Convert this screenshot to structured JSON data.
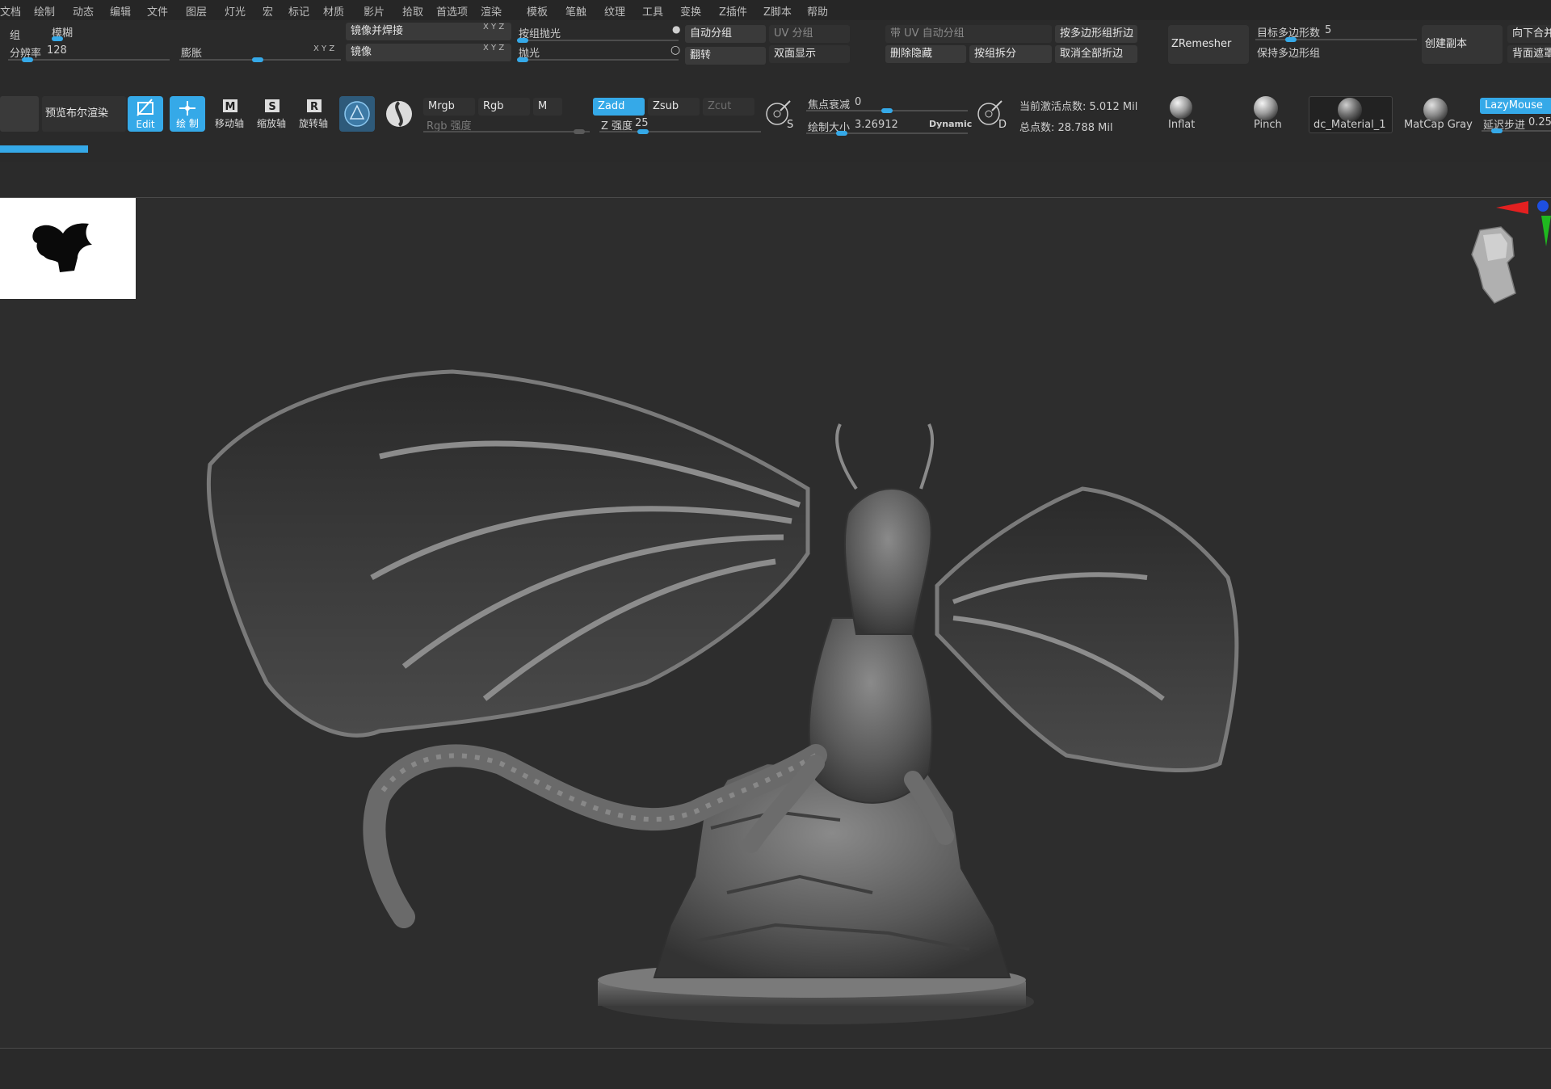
{
  "menu": [
    "文档",
    "绘制",
    "动态",
    "编辑",
    "文件",
    "图层",
    "灯光",
    "宏",
    "标记",
    "材质",
    "影片",
    "拾取",
    "首选项",
    "渲染",
    "模板",
    "笔触",
    "纹理",
    "工具",
    "变换",
    "Z插件",
    "Z脚本",
    "帮助"
  ],
  "row1": {
    "group": "组",
    "blur": "模糊",
    "resolution_label": "分辨率",
    "resolution_value": "128",
    "inflate": "膨胀",
    "xyz": "X Y Z",
    "mirror_weld": "镜像并焊接",
    "mirror": "镜像",
    "polish_by_groups": "按组抛光",
    "polish": "抛光",
    "auto_groups": "自动分组",
    "flip": "翻转",
    "uv_groups": "UV 分组",
    "double_sided": "双面显示",
    "with_uv_auto_groups": "带 UV 自动分组",
    "delete_hidden": "删除隐藏",
    "split_groups": "按组拆分",
    "crease_pg": "按多边形组折边",
    "uncrease_all": "取消全部折边",
    "zremesher": "ZRemesher",
    "target_polycount_label": "目标多边形数",
    "target_polycount_value": "5",
    "keep_groups": "保持多边形组",
    "make_copy": "创建副本",
    "merge_down": "向下合并",
    "backface_mask": "背面遮罩"
  },
  "row2": {
    "preview_render": "预览布尔渲染",
    "tools": [
      {
        "label": "Edit",
        "on": true,
        "glyph": "edit"
      },
      {
        "label": "绘 制",
        "on": true,
        "glyph": "draw"
      },
      {
        "label": "移动轴",
        "on": false,
        "glyph": "M"
      },
      {
        "label": "缩放轴",
        "on": false,
        "glyph": "S"
      },
      {
        "label": "旋转轴",
        "on": false,
        "glyph": "R"
      }
    ],
    "mrgb": "Mrgb",
    "rgb": "Rgb",
    "m": "M",
    "rgb_intensity": "Rgb 强度",
    "zadd": "Zadd",
    "zsub": "Zsub",
    "zcut": "Zcut",
    "z_intensity_label": "Z 强度",
    "z_intensity_value": "25",
    "focal_shift_label": "焦点衰减",
    "focal_shift_value": "0",
    "draw_size_label": "绘制大小",
    "draw_size_value": "3.26912",
    "dynamic": "Dynamic",
    "active_points": "当前激活点数: 5.012 Mil",
    "total_points": "总点数: 28.788 Mil",
    "brush_s": "S",
    "brush_d": "D",
    "materials": [
      "Inflat",
      "Pinch",
      "dc_Material_1",
      "MatCap Gray"
    ],
    "lazymouse": "LazyMouse",
    "lazy_step_label": "延迟步进",
    "lazy_step_value": "0.25"
  },
  "sliders": {
    "resolution": 0.09,
    "z_intensity": 0.25,
    "focal_shift": 0.5,
    "draw_size": 0.2,
    "target_polycount": 0.2
  },
  "progress": 0.05
}
